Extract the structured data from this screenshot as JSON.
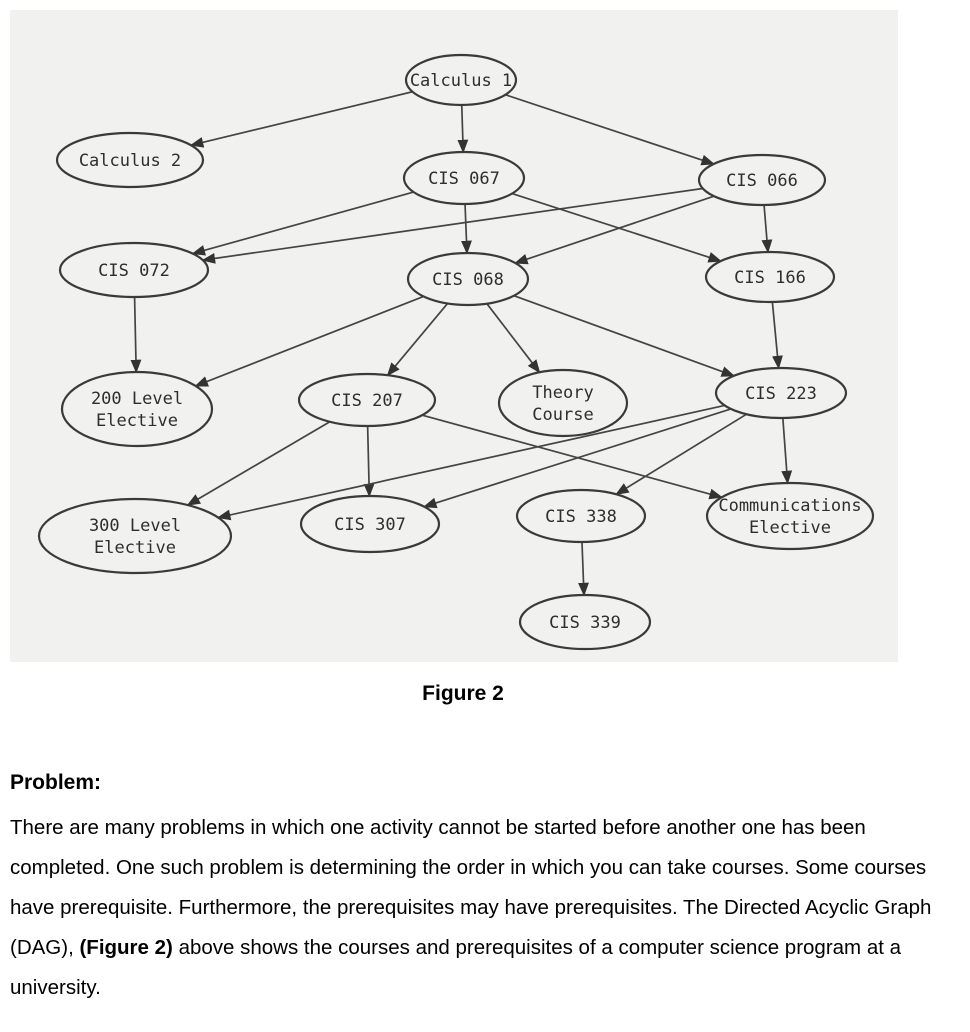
{
  "figure": {
    "caption": "Figure 2",
    "nodes": [
      {
        "id": "calc1",
        "lines": [
          "Calculus 1"
        ]
      },
      {
        "id": "calc2",
        "lines": [
          "Calculus 2"
        ]
      },
      {
        "id": "cis067",
        "lines": [
          "CIS 067"
        ]
      },
      {
        "id": "cis066",
        "lines": [
          "CIS 066"
        ]
      },
      {
        "id": "cis072",
        "lines": [
          "CIS 072"
        ]
      },
      {
        "id": "cis068",
        "lines": [
          "CIS 068"
        ]
      },
      {
        "id": "cis166",
        "lines": [
          "CIS 166"
        ]
      },
      {
        "id": "el200",
        "lines": [
          "200 Level",
          "Elective"
        ]
      },
      {
        "id": "cis207",
        "lines": [
          "CIS 207"
        ]
      },
      {
        "id": "theory",
        "lines": [
          "Theory",
          "Course"
        ]
      },
      {
        "id": "cis223",
        "lines": [
          "CIS 223"
        ]
      },
      {
        "id": "el300",
        "lines": [
          "300 Level",
          "Elective"
        ]
      },
      {
        "id": "cis307",
        "lines": [
          "CIS 307"
        ]
      },
      {
        "id": "cis338",
        "lines": [
          "CIS 338"
        ]
      },
      {
        "id": "comm",
        "lines": [
          "Communications",
          "Elective"
        ]
      },
      {
        "id": "cis339",
        "lines": [
          "CIS 339"
        ]
      }
    ],
    "edges": [
      [
        "calc1",
        "calc2"
      ],
      [
        "calc1",
        "cis067"
      ],
      [
        "calc1",
        "cis066"
      ],
      [
        "cis067",
        "cis072"
      ],
      [
        "cis067",
        "cis068"
      ],
      [
        "cis067",
        "cis166"
      ],
      [
        "cis066",
        "cis072"
      ],
      [
        "cis066",
        "cis068"
      ],
      [
        "cis066",
        "cis166"
      ],
      [
        "cis072",
        "el200"
      ],
      [
        "cis068",
        "el200"
      ],
      [
        "cis068",
        "cis207"
      ],
      [
        "cis068",
        "theory"
      ],
      [
        "cis068",
        "cis223"
      ],
      [
        "cis166",
        "cis223"
      ],
      [
        "cis207",
        "el300"
      ],
      [
        "cis207",
        "cis307"
      ],
      [
        "cis207",
        "comm"
      ],
      [
        "cis223",
        "el300"
      ],
      [
        "cis223",
        "cis307"
      ],
      [
        "cis223",
        "cis338"
      ],
      [
        "cis223",
        "comm"
      ],
      [
        "cis338",
        "cis339"
      ]
    ]
  },
  "problem": {
    "title": "Problem:",
    "text_before": "There are many problems in which one activity cannot be started before another one has been completed. One such problem is determining the order in which you can take courses. Some courses have prerequisite. Furthermore, the prerequisites may have prerequisites. The Directed Acyclic Graph (DAG), ",
    "bold_ref": "(Figure 2)",
    "text_after": " above shows the courses and prerequisites of a computer science program at a university."
  }
}
